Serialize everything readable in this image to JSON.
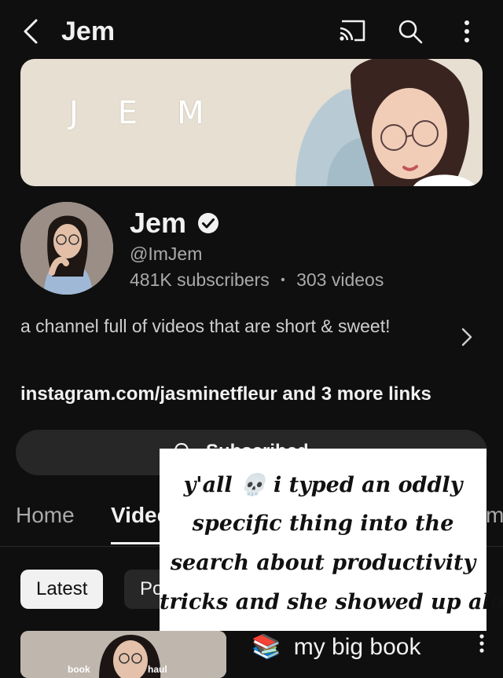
{
  "topbar": {
    "title": "Jem",
    "icons": [
      "back-chevron-icon",
      "cast-icon",
      "search-icon",
      "more-vert-icon"
    ]
  },
  "banner": {
    "letters": [
      "J",
      "E",
      "M"
    ]
  },
  "channel": {
    "name": "Jem",
    "handle": "@ImJem",
    "subscribers": "481K subscribers",
    "separator": "•",
    "videos": "303 videos",
    "description": "a channel full of videos that are short & sweet!",
    "links": "instagram.com/jasminetfleur and 3 more links"
  },
  "subscribe_button": {
    "label": "Subscribed"
  },
  "tabs": [
    {
      "label": "Home",
      "active": false
    },
    {
      "label": "Videos",
      "active": true
    },
    {
      "label": "m",
      "active": false
    }
  ],
  "chips": [
    {
      "label": "Latest",
      "active": true
    },
    {
      "label": "Popular",
      "active": false
    }
  ],
  "video": {
    "title_emoji": "📚",
    "title": "my big book",
    "thumb_text_left": "book",
    "thumb_text_right": "haul"
  },
  "overlay": {
    "lines": [
      "y'all 💀 i typed an oddly",
      "specific thing into the",
      "search about productivity",
      "tricks and she showed up alot"
    ]
  },
  "colors": {
    "background": "#0f0f0f",
    "text_primary": "#f1f1f1",
    "text_secondary": "#aaaaaa",
    "chip_active_bg": "#f1f1f1",
    "button_bg": "#272727",
    "banner_bg": "#e6dfd2"
  }
}
